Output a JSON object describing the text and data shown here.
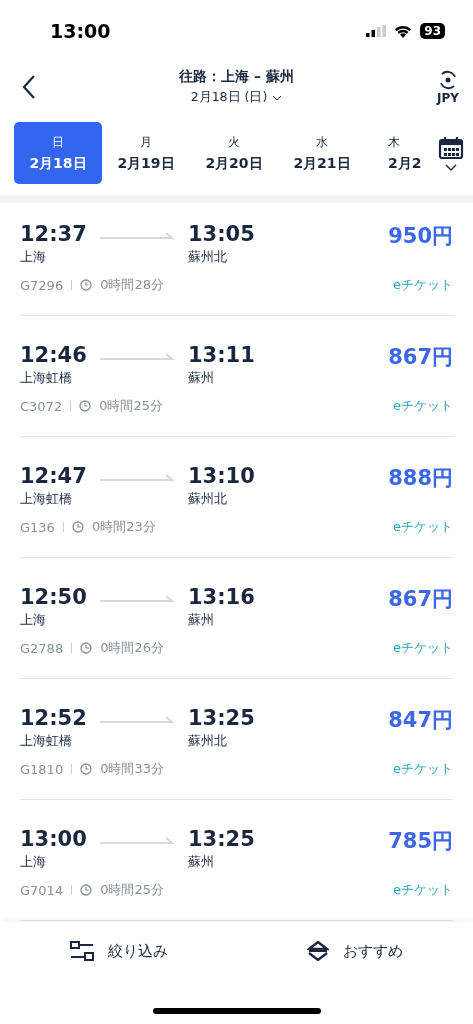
{
  "status_bar": {
    "time": "13:00",
    "battery": "93"
  },
  "header": {
    "title": "往路：上海 – 蘇州",
    "date": "2月18日 (日)",
    "currency": "JPY"
  },
  "date_tabs": [
    {
      "weekday": "日",
      "date": "2月18日",
      "selected": true
    },
    {
      "weekday": "月",
      "date": "2月19日",
      "selected": false
    },
    {
      "weekday": "火",
      "date": "2月20日",
      "selected": false
    },
    {
      "weekday": "水",
      "date": "2月21日",
      "selected": false
    },
    {
      "weekday": "木",
      "date": "2月2",
      "selected": false
    }
  ],
  "trains": [
    {
      "depart": "12:37",
      "from": "上海",
      "arrive": "13:05",
      "to": "蘇州北",
      "price": "950円",
      "number": "G7296",
      "duration": "0時間28分",
      "ticket": "eチケット"
    },
    {
      "depart": "12:46",
      "from": "上海虹橋",
      "arrive": "13:11",
      "to": "蘇州",
      "price": "867円",
      "number": "C3072",
      "duration": "0時間25分",
      "ticket": "eチケット"
    },
    {
      "depart": "12:47",
      "from": "上海虹橋",
      "arrive": "13:10",
      "to": "蘇州北",
      "price": "888円",
      "number": "G136",
      "duration": "0時間23分",
      "ticket": "eチケット"
    },
    {
      "depart": "12:50",
      "from": "上海",
      "arrive": "13:16",
      "to": "蘇州",
      "price": "867円",
      "number": "G2788",
      "duration": "0時間26分",
      "ticket": "eチケット"
    },
    {
      "depart": "12:52",
      "from": "上海虹橋",
      "arrive": "13:25",
      "to": "蘇州北",
      "price": "847円",
      "number": "G1810",
      "duration": "0時間33分",
      "ticket": "eチケット"
    },
    {
      "depart": "13:00",
      "from": "上海",
      "arrive": "13:25",
      "to": "蘇州",
      "price": "785円",
      "number": "G7014",
      "duration": "0時間25分",
      "ticket": "eチケット"
    }
  ],
  "bottom_bar": {
    "filter": "絞り込み",
    "sort": "おすすめ"
  }
}
